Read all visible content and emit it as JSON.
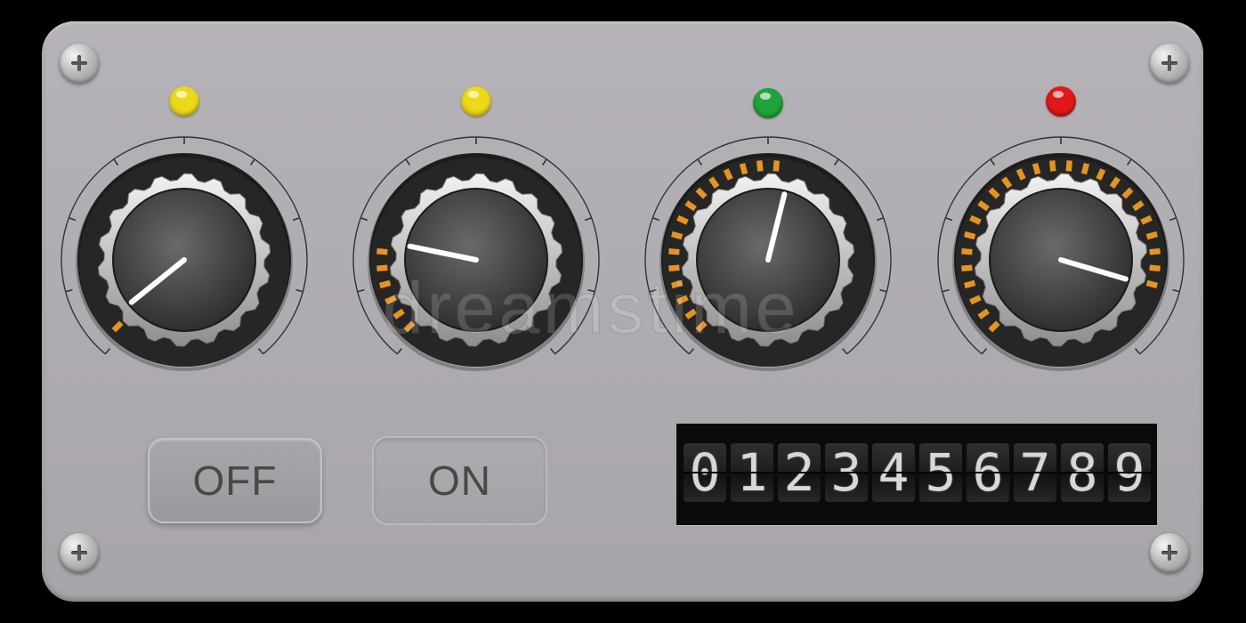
{
  "leds": [
    {
      "color": "#ecd91a"
    },
    {
      "color": "#ecd91a"
    },
    {
      "color": "#20a33c"
    },
    {
      "color": "#e0181a"
    }
  ],
  "knobs": [
    {
      "level": 0.04
    },
    {
      "level": 0.22
    },
    {
      "level": 0.55
    },
    {
      "level": 0.88
    }
  ],
  "buttons": {
    "off_label": "OFF",
    "on_label": "ON"
  },
  "counter": {
    "digits": [
      "0",
      "1",
      "2",
      "3",
      "4",
      "5",
      "6",
      "7",
      "8",
      "9"
    ]
  },
  "watermark": "dreamstime",
  "colors": {
    "panel": "#aba8ad",
    "level_arc": "#e59422",
    "knob_body": "#2a2a2a"
  }
}
